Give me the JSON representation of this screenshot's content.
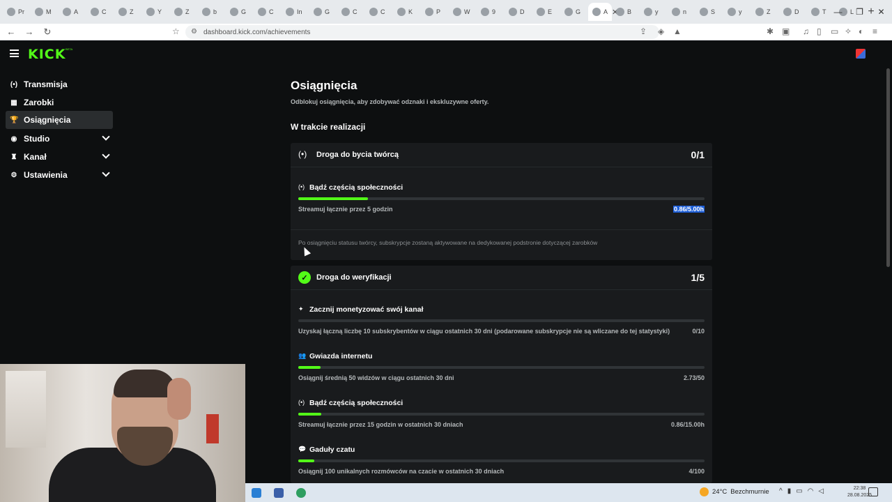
{
  "browser": {
    "tabs": [
      "Pr",
      "M",
      "A",
      "C",
      "Z",
      "Y",
      "Z",
      "b",
      "G",
      "C",
      "In",
      "G",
      "C",
      "C",
      "K",
      "P",
      "W",
      "9",
      "D",
      "E",
      "G",
      "A",
      "B",
      "y",
      "n",
      "S",
      "y",
      "Z",
      "D",
      "T",
      "L"
    ],
    "active_tab_index": 21,
    "url": "dashboard.kick.com/achievements"
  },
  "app": {
    "logo": "KICK",
    "logo_badge": "BETA"
  },
  "sidebar": {
    "items": [
      {
        "label": "Transmisja",
        "icon": "broadcast-icon",
        "glyph": "(•)"
      },
      {
        "label": "Zarobki",
        "icon": "earnings-icon",
        "glyph": "▦"
      },
      {
        "label": "Osiągnięcia",
        "icon": "trophy-icon",
        "glyph": "🏆"
      },
      {
        "label": "Studio",
        "icon": "studio-icon",
        "glyph": "◉"
      },
      {
        "label": "Kanał",
        "icon": "channel-icon",
        "glyph": "♜"
      },
      {
        "label": "Ustawienia",
        "icon": "gear-icon",
        "glyph": "⚙"
      }
    ]
  },
  "page": {
    "title": "Osiągnięcia",
    "subtitle": "Odblokuj osiągnięcia, aby zdobywać odznaki i ekskluzywne oferty.",
    "section_in_progress": "W trakcie realizacji"
  },
  "creator_card": {
    "title": "Droga do bycia twórcą",
    "count": "0/1",
    "achievement": {
      "title": "Bądź częścią społeczności",
      "desc": "Streamuj łącznie przez 5 godzin",
      "value": "0.86/5.00h",
      "progress": 0.172
    },
    "footer": "Po osiągnięciu statusu twórcy, subskrypcje zostaną aktywowane na dedykowanej podstronie dotyczącej zarobków"
  },
  "verify_card": {
    "title": "Droga do weryfikacji",
    "count": "1/5",
    "achievements": [
      {
        "title": "Zacznij monetyzować swój kanał",
        "icon": "sparkle-icon",
        "glyph": "✦",
        "desc": "Uzyskaj łączną liczbę 10 subskrybentów w ciągu ostatnich 30 dni (podarowane subskrypcje nie są wliczane do tej statystyki)",
        "value": "0/10",
        "progress": 0.0
      },
      {
        "title": "Gwiazda internetu",
        "icon": "users-icon",
        "glyph": "👥",
        "desc": "Osiągnij średnią 50 widzów w ciągu ostatnich 30 dni",
        "value": "2.73/50",
        "progress": 0.0546
      },
      {
        "title": "Bądź częścią społeczności",
        "icon": "broadcast-icon",
        "glyph": "(•)",
        "desc": "Streamuj łącznie przez 15 godzin w ostatnich 30 dniach",
        "value": "0.86/15.00h",
        "progress": 0.0573
      },
      {
        "title": "Gaduły czatu",
        "icon": "chat-icon",
        "glyph": "💬",
        "desc": "Osiągnij 100 unikalnych rozmówców na czacie w ostatnich 30 dniach",
        "value": "4/100",
        "progress": 0.04
      }
    ]
  },
  "taskbar": {
    "temperature": "24°C",
    "weather": "Bezchmurnie",
    "time": "22:38",
    "date": "28.08.2025"
  },
  "colors": {
    "accent": "#53fc18",
    "background": "#0d0f10",
    "card": "#191b1d"
  }
}
